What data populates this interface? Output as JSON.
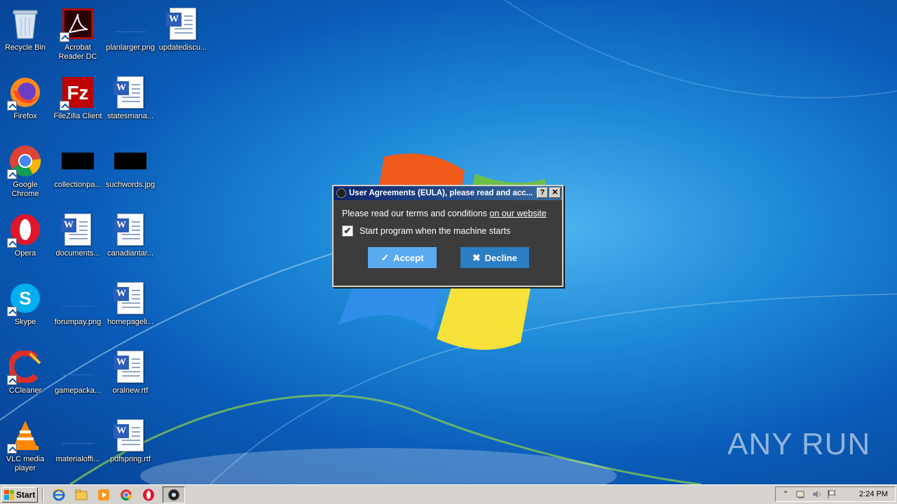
{
  "desktop": {
    "icons": [
      {
        "label": "Recycle Bin"
      },
      {
        "label": "Acrobat Reader DC"
      },
      {
        "label": "planlarger.png"
      },
      {
        "label": "updatediscu..."
      },
      {
        "label": "Firefox"
      },
      {
        "label": "FileZilla Client"
      },
      {
        "label": "statesmana..."
      },
      {
        "label": "Google Chrome"
      },
      {
        "label": "collectionpa..."
      },
      {
        "label": "suchwords.jpg"
      },
      {
        "label": "Opera"
      },
      {
        "label": "documents..."
      },
      {
        "label": "canadiantar..."
      },
      {
        "label": "Skype"
      },
      {
        "label": "forumpay.png"
      },
      {
        "label": "homepageli..."
      },
      {
        "label": "CCleaner"
      },
      {
        "label": "gamepacka..."
      },
      {
        "label": "oralnew.rtf"
      },
      {
        "label": "VLC media player"
      },
      {
        "label": "materialoffi..."
      },
      {
        "label": "pdfspring.rtf"
      }
    ]
  },
  "dialog": {
    "title": "User Agreements (EULA), please read and acc...",
    "help_btn": "?",
    "close_btn": "✕",
    "message": "Please read our terms and conditions ",
    "link": "on our website",
    "checkbox_label": "Start program when the machine starts",
    "checkbox_checked": true,
    "accept_label": "Accept",
    "decline_label": "Decline"
  },
  "watermark": {
    "text": "ANY RUN"
  },
  "taskbar": {
    "start_label": "Start",
    "clock": "2:24 PM",
    "quick_launch": [
      "internet-explorer-icon",
      "file-explorer-icon",
      "media-player-icon",
      "chrome-icon",
      "opera-icon"
    ],
    "active_app": "eula-app-icon"
  },
  "colors": {
    "accept_btn": "#5aaaf0",
    "decline_btn": "#2a7ec4",
    "dialog_bg": "#3c3c3c"
  }
}
